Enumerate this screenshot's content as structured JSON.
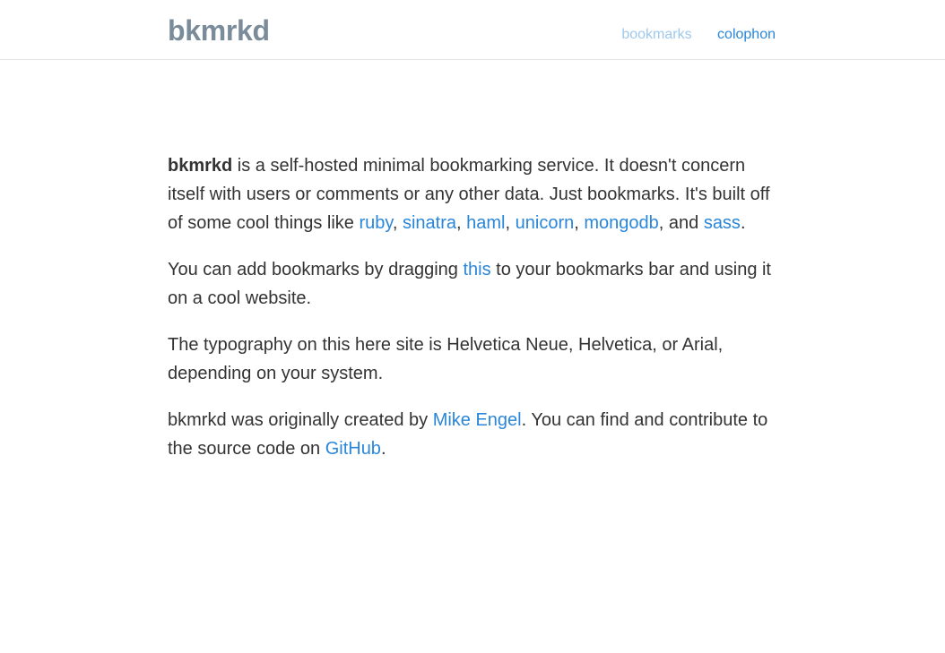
{
  "header": {
    "logo": "bkmrkd",
    "nav": {
      "bookmarks": "bookmarks",
      "colophon": "colophon"
    }
  },
  "content": {
    "p1": {
      "brand": "bkmrkd",
      "text1": " is a self-hosted minimal bookmarking service. It doesn't concern itself with users or comments or any other data. Just bookmarks. It's built off of some cool things like ",
      "ruby": "ruby",
      "sep1": ", ",
      "sinatra": "sinatra",
      "sep2": ", ",
      "haml": "haml",
      "sep3": ", ",
      "unicorn": "unicorn",
      "sep4": ", ",
      "mongodb": "mongodb",
      "sep5": ", and ",
      "sass": "sass",
      "end": "."
    },
    "p2": {
      "text1": "You can add bookmarks by dragging ",
      "link": "this",
      "text2": " to your bookmarks bar and using it on a cool website."
    },
    "p3": {
      "text": "The typography on this here site is Helvetica Neue, Helvetica, or Arial, depending on your system."
    },
    "p4": {
      "text1": "bkmrkd was originally created by ",
      "author": "Mike Engel",
      "text2": ". You can find and contribute to the source code on ",
      "github": "GitHub",
      "end": "."
    }
  },
  "colors": {
    "link": "#2a86d8",
    "link_active_faded": "#9ec9ee",
    "logo": "#7a8b9a",
    "text": "#333333"
  }
}
